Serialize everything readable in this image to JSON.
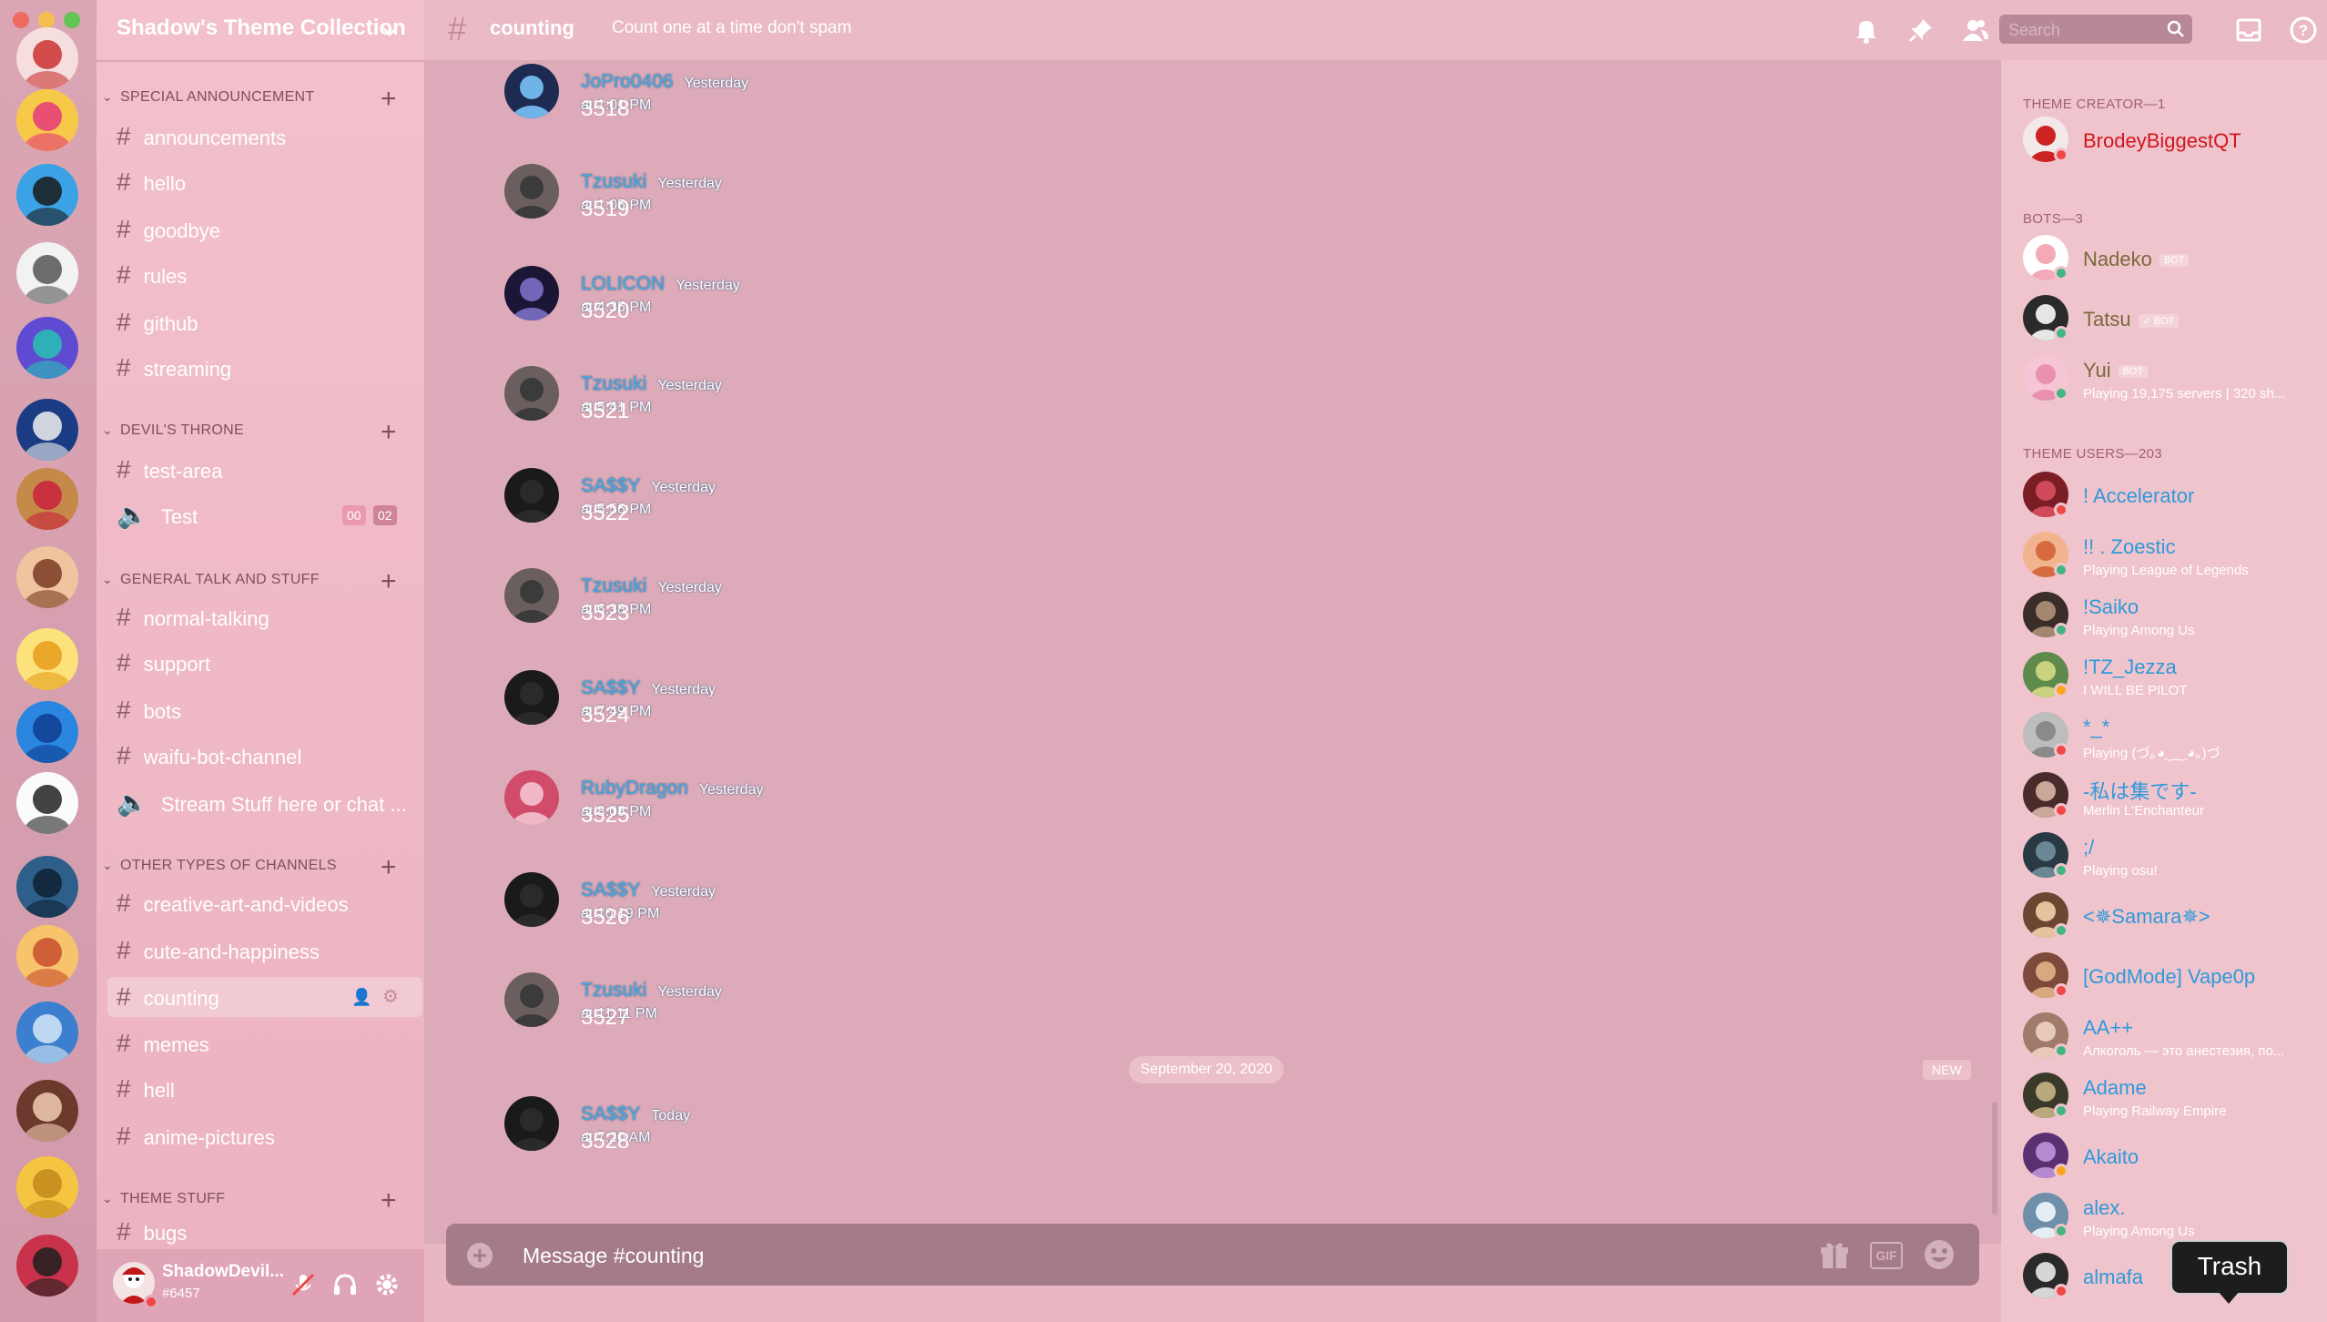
{
  "guild": {
    "name": "Shadow's Theme Collection"
  },
  "categories": [
    {
      "label": "SPECIAL ANNOUNCEMENT"
    },
    {
      "label": "DEVIL'S THRONE"
    },
    {
      "label": "GENERAL TALK AND STUFF"
    },
    {
      "label": "OTHER TYPES OF CHANNELS"
    },
    {
      "label": "THEME STUFF"
    }
  ],
  "channels": [
    {
      "name": "announcements"
    },
    {
      "name": "hello"
    },
    {
      "name": "goodbye"
    },
    {
      "name": "rules"
    },
    {
      "name": "github"
    },
    {
      "name": "streaming"
    },
    {
      "name": "test-area"
    },
    {
      "name": "Test",
      "badge_left": "00",
      "badge_right": "02"
    },
    {
      "name": "normal-talking"
    },
    {
      "name": "support"
    },
    {
      "name": "bots"
    },
    {
      "name": "waifu-bot-channel"
    },
    {
      "name": "Stream Stuff here or chat ..."
    },
    {
      "name": "creative-art-and-videos"
    },
    {
      "name": "cute-and-happiness"
    },
    {
      "name": "counting"
    },
    {
      "name": "memes"
    },
    {
      "name": "hell"
    },
    {
      "name": "anime-pictures"
    },
    {
      "name": "bugs"
    }
  ],
  "user": {
    "name": "ShadowDevil...",
    "tag": "#6457"
  },
  "topbar": {
    "channel": "counting",
    "topic": "Count one at a time don't spam",
    "search_placeholder": "Search"
  },
  "messages": [
    {
      "author": "JoPro0406",
      "time": "Yesterday at 1:01 PM",
      "text": "3518"
    },
    {
      "author": "Tzusuki",
      "time": "Yesterday at 1:05 PM",
      "text": "3519"
    },
    {
      "author": "LOLICON",
      "time": "Yesterday at 4:35 PM",
      "text": "3520"
    },
    {
      "author": "Tzusuki",
      "time": "Yesterday at 5:41 PM",
      "text": "3521"
    },
    {
      "author": "SA$$Y",
      "time": "Yesterday at 5:56 PM",
      "text": "3522"
    },
    {
      "author": "Tzusuki",
      "time": "Yesterday at 6:38 PM",
      "text": "3523"
    },
    {
      "author": "SA$$Y",
      "time": "Yesterday at 7:49 PM",
      "text": "3524"
    },
    {
      "author": "RubyDragon",
      "time": "Yesterday at 8:08 PM",
      "text": "3525"
    },
    {
      "author": "SA$$Y",
      "time": "Yesterday at 10:19 PM",
      "text": "3526"
    },
    {
      "author": "Tzusuki",
      "time": "Yesterday at 11:11 PM",
      "text": "3527"
    },
    {
      "author": "SA$$Y",
      "time": "Today at 7:20 AM",
      "text": "3528"
    }
  ],
  "divider": {
    "date": "September 20, 2020",
    "new": "NEW"
  },
  "composer": {
    "placeholder": "Message #counting",
    "gif": "GIF"
  },
  "members": {
    "creator_header": "THEME CREATOR—1",
    "bots_header": "BOTS—3",
    "users_header": "THEME USERS—203",
    "creator": [
      {
        "name": "BrodeyBiggestQT"
      }
    ],
    "bots": [
      {
        "name": "Nadeko",
        "badge": "BOT"
      },
      {
        "name": "Tatsu",
        "badge": "✓ BOT"
      },
      {
        "name": "Yui",
        "badge": "BOT",
        "activity": "Playing 19,175 servers | 320 sh..."
      }
    ],
    "users": [
      {
        "name": "! Accelerator",
        "activity": ""
      },
      {
        "name": "!! . Zoestic",
        "activity": "Playing League of Legends"
      },
      {
        "name": "!Saiko",
        "activity": "Playing Among Us"
      },
      {
        "name": "!TZ_Jezza",
        "activity": "I WILL BE PILOT"
      },
      {
        "name": "*_*",
        "activity": "Playing (づ｡◕‿‿◕｡)づ"
      },
      {
        "name": "-私は集です-",
        "activity": "Merlin L'Enchanteur"
      },
      {
        "name": ";/",
        "activity": "Playing osu!"
      },
      {
        "name": "<✵Samara✵>",
        "activity": ""
      },
      {
        "name": "[GodMode] Vape0p",
        "activity": ""
      },
      {
        "name": "AA++",
        "activity": "Алкоголь — это анестезия, по..."
      },
      {
        "name": "Adame",
        "activity": "Playing Railway Empire"
      },
      {
        "name": "Akaito",
        "activity": ""
      },
      {
        "name": "alex.",
        "activity": "Playing Among Us"
      },
      {
        "name": "almafa",
        "activity": ""
      }
    ]
  },
  "tooltip": {
    "label": "Trash"
  },
  "colors": {
    "accent": "#2e9ad9",
    "creator": "#d0161e",
    "bot": "#7a6a3a",
    "online": "#43b581",
    "dnd": "#f04747",
    "idle": "#faa61a"
  }
}
